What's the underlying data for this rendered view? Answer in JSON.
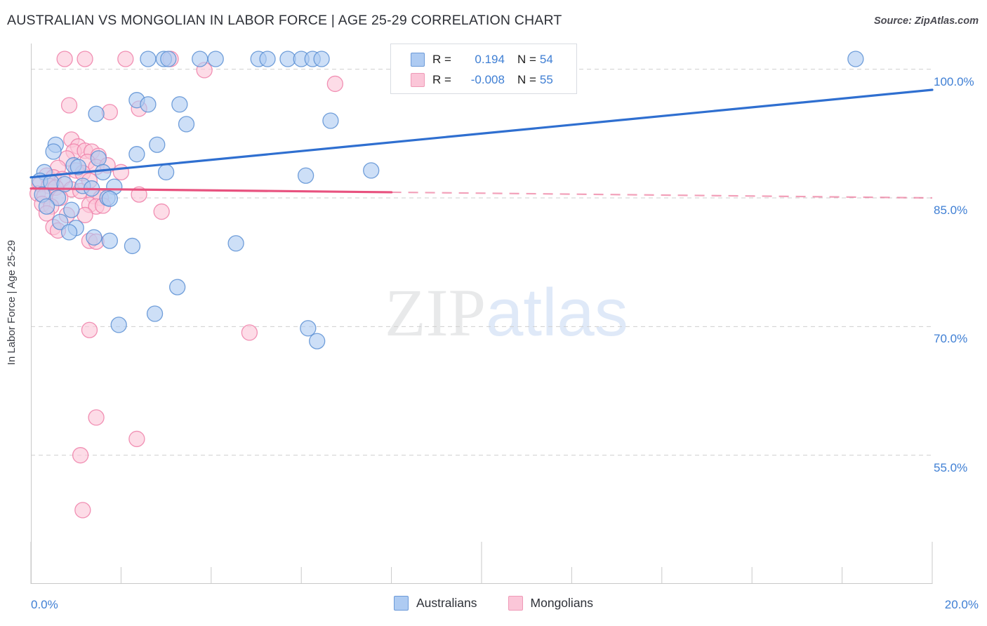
{
  "header": {
    "title": "AUSTRALIAN VS MONGOLIAN IN LABOR FORCE | AGE 25-29 CORRELATION CHART",
    "source": "Source: ZipAtlas.com"
  },
  "watermark": {
    "part1": "ZIP",
    "part2": "atlas"
  },
  "axes": {
    "y_title": "In Labor Force | Age 25-29",
    "y_ticks": [
      "100.0%",
      "85.0%",
      "70.0%",
      "55.0%"
    ],
    "x_tick_min": "0.0%",
    "x_tick_max": "20.0%"
  },
  "correlation_legend": {
    "rows": [
      {
        "series": "Australians",
        "r_label": "R =",
        "r_value": "0.194",
        "n_label": "N =",
        "n_value": "54",
        "color": "#aecbf2"
      },
      {
        "series": "Mongolians",
        "r_label": "R =",
        "r_value": "-0.008",
        "n_label": "N =",
        "n_value": "55",
        "color": "#fbc6d8"
      }
    ]
  },
  "series_legend": [
    {
      "label": "Australians",
      "color": "#aecbf2"
    },
    {
      "label": "Mongolians",
      "color": "#fbc6d8"
    }
  ],
  "chart_data": {
    "type": "scatter",
    "title": "AUSTRALIAN VS MONGOLIAN IN LABOR FORCE | AGE 25-29 CORRELATION CHART",
    "xlabel": "",
    "ylabel": "In Labor Force | Age 25-29",
    "xlim": [
      0.0,
      20.0
    ],
    "ylim": [
      40.0,
      103.0
    ],
    "x_ticks": [
      0.0,
      2.0,
      4.0,
      6.0,
      8.0,
      10.0,
      12.0,
      14.0,
      16.0,
      18.0,
      20.0
    ],
    "x_tick_labels_shown": [
      "0.0%",
      "20.0%"
    ],
    "y_ticks": [
      100.0,
      85.0,
      70.0,
      55.0
    ],
    "grid": "horizontal-dashed",
    "legend_position": "bottom-center",
    "series": [
      {
        "name": "Australians",
        "color": "#aecbf2",
        "edge_color": "#5b8fd4",
        "r": 0.194,
        "n": 54,
        "trendline": {
          "x0": 0.0,
          "y0": 87.4,
          "x1": 20.0,
          "y1": 97.6,
          "style": "solid",
          "color": "#2f6fd0"
        },
        "points": [
          {
            "x": 2.6,
            "y": 101.2
          },
          {
            "x": 2.95,
            "y": 101.2
          },
          {
            "x": 3.05,
            "y": 101.2
          },
          {
            "x": 3.75,
            "y": 101.2
          },
          {
            "x": 4.1,
            "y": 101.2
          },
          {
            "x": 5.05,
            "y": 101.2
          },
          {
            "x": 5.25,
            "y": 101.2
          },
          {
            "x": 5.7,
            "y": 101.2
          },
          {
            "x": 6.0,
            "y": 101.2
          },
          {
            "x": 6.25,
            "y": 101.2
          },
          {
            "x": 6.45,
            "y": 101.2
          },
          {
            "x": 18.3,
            "y": 101.2
          },
          {
            "x": 2.35,
            "y": 96.4
          },
          {
            "x": 2.6,
            "y": 95.9
          },
          {
            "x": 3.3,
            "y": 95.9
          },
          {
            "x": 1.45,
            "y": 94.8
          },
          {
            "x": 3.45,
            "y": 93.6
          },
          {
            "x": 6.65,
            "y": 94.0
          },
          {
            "x": 2.8,
            "y": 91.2
          },
          {
            "x": 2.35,
            "y": 90.1
          },
          {
            "x": 0.55,
            "y": 91.2
          },
          {
            "x": 0.5,
            "y": 90.4
          },
          {
            "x": 1.5,
            "y": 89.6
          },
          {
            "x": 0.95,
            "y": 88.8
          },
          {
            "x": 1.05,
            "y": 88.6
          },
          {
            "x": 3.0,
            "y": 88.0
          },
          {
            "x": 1.6,
            "y": 88.0
          },
          {
            "x": 0.3,
            "y": 88.0
          },
          {
            "x": 6.1,
            "y": 87.6
          },
          {
            "x": 7.55,
            "y": 88.2
          },
          {
            "x": 0.2,
            "y": 87.0
          },
          {
            "x": 0.45,
            "y": 86.8
          },
          {
            "x": 0.75,
            "y": 86.6
          },
          {
            "x": 1.15,
            "y": 86.4
          },
          {
            "x": 1.35,
            "y": 86.1
          },
          {
            "x": 1.85,
            "y": 86.3
          },
          {
            "x": 0.25,
            "y": 85.4
          },
          {
            "x": 0.6,
            "y": 85.0
          },
          {
            "x": 1.7,
            "y": 85.0
          },
          {
            "x": 1.75,
            "y": 84.9
          },
          {
            "x": 0.35,
            "y": 84.0
          },
          {
            "x": 0.9,
            "y": 83.6
          },
          {
            "x": 0.65,
            "y": 82.2
          },
          {
            "x": 1.0,
            "y": 81.5
          },
          {
            "x": 0.85,
            "y": 81.0
          },
          {
            "x": 1.4,
            "y": 80.4
          },
          {
            "x": 1.75,
            "y": 80.0
          },
          {
            "x": 2.25,
            "y": 79.4
          },
          {
            "x": 4.55,
            "y": 79.7
          },
          {
            "x": 3.25,
            "y": 74.6
          },
          {
            "x": 2.75,
            "y": 71.5
          },
          {
            "x": 1.95,
            "y": 70.2
          },
          {
            "x": 6.15,
            "y": 69.8
          },
          {
            "x": 6.35,
            "y": 68.3
          }
        ]
      },
      {
        "name": "Mongolians",
        "color": "#fbc6d8",
        "edge_color": "#ef7fa8",
        "r": -0.008,
        "n": 55,
        "trendline": {
          "x0": 0.0,
          "y0": 86.1,
          "x1": 20.0,
          "y1": 85.0,
          "style": "solid-then-dashed",
          "solid_until_x": 8.0,
          "color": "#e8527f"
        },
        "points": [
          {
            "x": 0.75,
            "y": 101.2
          },
          {
            "x": 1.2,
            "y": 101.2
          },
          {
            "x": 2.1,
            "y": 101.2
          },
          {
            "x": 3.1,
            "y": 101.2
          },
          {
            "x": 3.85,
            "y": 99.9
          },
          {
            "x": 6.75,
            "y": 98.3
          },
          {
            "x": 0.85,
            "y": 95.8
          },
          {
            "x": 1.75,
            "y": 95.0
          },
          {
            "x": 2.4,
            "y": 95.4
          },
          {
            "x": 0.9,
            "y": 91.8
          },
          {
            "x": 1.05,
            "y": 91.0
          },
          {
            "x": 0.95,
            "y": 90.4
          },
          {
            "x": 1.2,
            "y": 90.5
          },
          {
            "x": 1.35,
            "y": 90.4
          },
          {
            "x": 1.5,
            "y": 89.9
          },
          {
            "x": 0.8,
            "y": 89.6
          },
          {
            "x": 1.25,
            "y": 89.2
          },
          {
            "x": 1.45,
            "y": 88.6
          },
          {
            "x": 1.7,
            "y": 88.8
          },
          {
            "x": 0.6,
            "y": 88.5
          },
          {
            "x": 1.0,
            "y": 88.2
          },
          {
            "x": 1.15,
            "y": 87.9
          },
          {
            "x": 2.0,
            "y": 88.0
          },
          {
            "x": 0.35,
            "y": 87.6
          },
          {
            "x": 0.5,
            "y": 87.4
          },
          {
            "x": 0.7,
            "y": 87.2
          },
          {
            "x": 1.3,
            "y": 87.0
          },
          {
            "x": 0.2,
            "y": 86.6
          },
          {
            "x": 0.4,
            "y": 86.4
          },
          {
            "x": 0.55,
            "y": 86.2
          },
          {
            "x": 0.9,
            "y": 86.0
          },
          {
            "x": 1.1,
            "y": 85.8
          },
          {
            "x": 0.15,
            "y": 85.5
          },
          {
            "x": 0.3,
            "y": 85.2
          },
          {
            "x": 0.65,
            "y": 85.0
          },
          {
            "x": 1.4,
            "y": 85.2
          },
          {
            "x": 1.55,
            "y": 85.0
          },
          {
            "x": 2.4,
            "y": 85.4
          },
          {
            "x": 0.25,
            "y": 84.3
          },
          {
            "x": 0.45,
            "y": 84.0
          },
          {
            "x": 1.3,
            "y": 84.2
          },
          {
            "x": 1.45,
            "y": 84.0
          },
          {
            "x": 1.6,
            "y": 84.1
          },
          {
            "x": 0.35,
            "y": 83.2
          },
          {
            "x": 0.8,
            "y": 83.0
          },
          {
            "x": 1.2,
            "y": 83.0
          },
          {
            "x": 2.9,
            "y": 83.4
          },
          {
            "x": 0.5,
            "y": 81.6
          },
          {
            "x": 0.6,
            "y": 81.2
          },
          {
            "x": 1.3,
            "y": 80.0
          },
          {
            "x": 1.45,
            "y": 79.9
          },
          {
            "x": 1.3,
            "y": 69.6
          },
          {
            "x": 4.85,
            "y": 69.3
          },
          {
            "x": 1.45,
            "y": 59.4
          },
          {
            "x": 2.35,
            "y": 56.9
          },
          {
            "x": 1.1,
            "y": 55.0
          },
          {
            "x": 1.15,
            "y": 48.6
          }
        ]
      }
    ]
  }
}
